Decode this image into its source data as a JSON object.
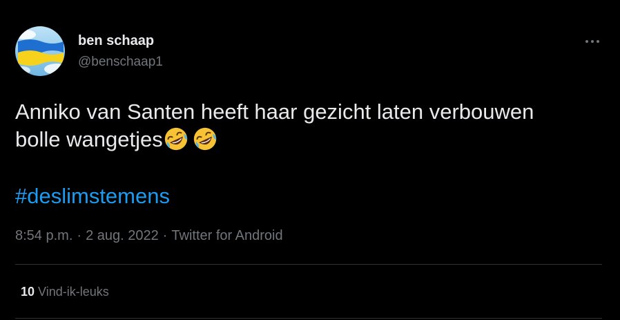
{
  "tweet": {
    "author": {
      "display_name": "ben schaap",
      "handle": "@benschaap1",
      "avatar_icon": "ukraine-flag-avatar"
    },
    "more_icon": "more-options-icon",
    "text": {
      "line1": "Anniko van Santen heeft haar gezicht laten verbouwen",
      "line2": "bolle wangetjes",
      "emoji": [
        "rolling-on-floor-laughing-emoji",
        "rolling-on-floor-laughing-emoji"
      ]
    },
    "hashtag": "#deslimstemens",
    "meta": {
      "time": "8:54 p.m.",
      "separator": "·",
      "date": "2 aug. 2022",
      "source": "Twitter for Android"
    },
    "likes": {
      "count": "10",
      "label": "Vind-ik-leuks"
    }
  },
  "colors": {
    "background": "#000000",
    "text_primary": "#e7e9ea",
    "text_secondary": "#71767b",
    "link": "#1d9bf0",
    "divider": "#2f3336"
  }
}
